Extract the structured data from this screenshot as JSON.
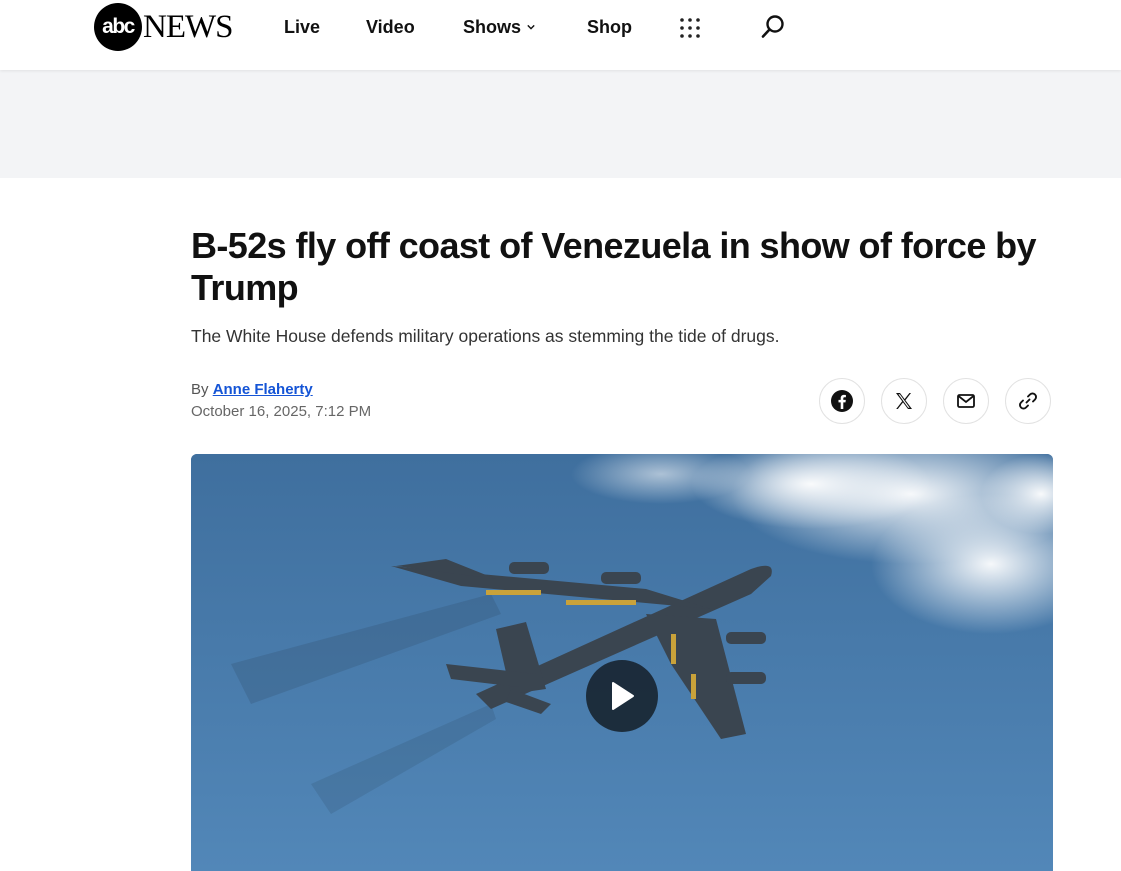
{
  "header": {
    "logo_abc": "abc",
    "logo_news": "NEWS",
    "nav": {
      "live": "Live",
      "video": "Video",
      "shows": "Shows",
      "shop": "Shop"
    },
    "icons": [
      "chevron-down-icon",
      "grid-menu-icon",
      "search-icon"
    ]
  },
  "article": {
    "headline": "B-52s fly off coast of Venezuela in show of force by Trump",
    "subhead": "The White House defends military operations as stemming the tide of drugs.",
    "by_prefix": "By",
    "author": "Anne Flaherty",
    "date": "October 16, 2025, 7:12 PM",
    "share_icons": [
      "facebook-icon",
      "x-icon",
      "mail-icon",
      "link-icon"
    ]
  },
  "media": {
    "icon": "play-icon"
  },
  "colors": {
    "author_link": "#1454d6",
    "ad_band": "#f3f4f6",
    "sky": "#4a7ba8"
  }
}
